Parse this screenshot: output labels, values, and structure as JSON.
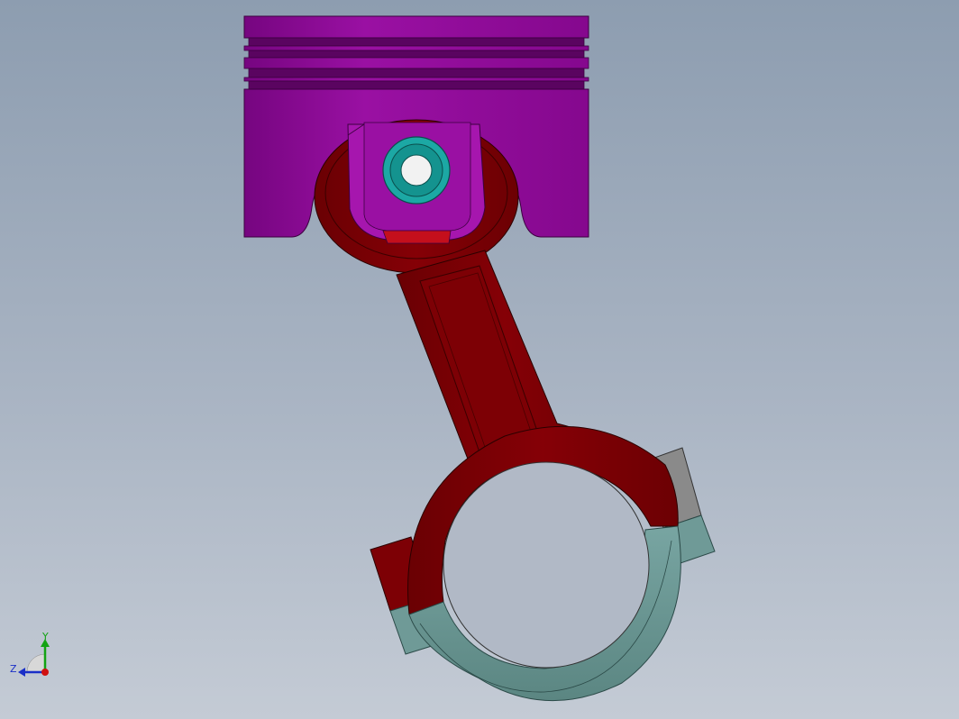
{
  "triad": {
    "y_label": "Y",
    "z_label": "Z"
  },
  "colors": {
    "piston": "#8e0a96",
    "piston_dark": "#6c0572",
    "rod": "#7a0004",
    "rod_dark": "#560003",
    "pin": "#1aa5a2",
    "cap": "#6f9a97",
    "bolt": "#8a8a8a",
    "background_top": "#8d9db0",
    "background_bottom": "#c4cbd5",
    "axis_y": "#13a313",
    "axis_z": "#1a2fc7",
    "axis_x": "#d01010"
  }
}
